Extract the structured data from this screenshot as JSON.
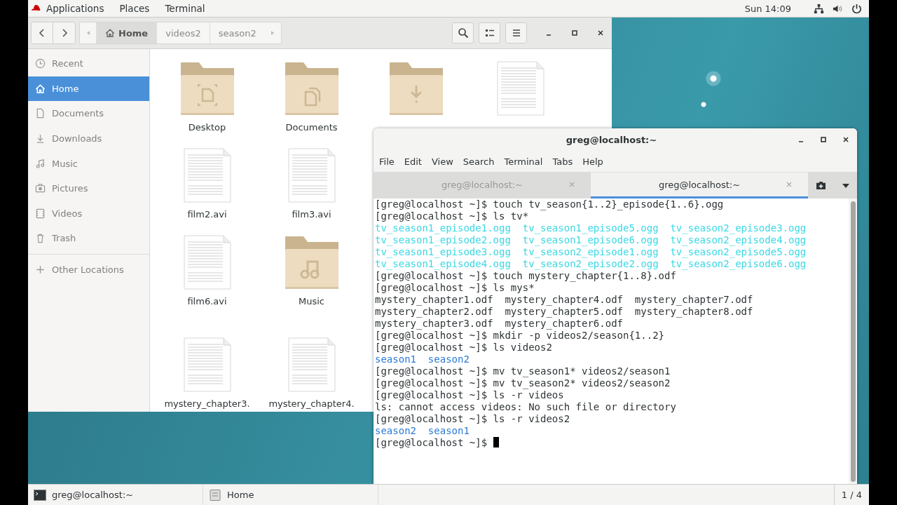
{
  "top_bar": {
    "menus": [
      "Applications",
      "Places",
      "Terminal"
    ],
    "clock": "Sun 14:09"
  },
  "file_manager": {
    "path": [
      {
        "label": "Home",
        "selected": true
      },
      {
        "label": "videos2",
        "selected": false
      },
      {
        "label": "season2",
        "selected": false
      }
    ],
    "sidebar": [
      {
        "label": "Recent",
        "kind": "recent",
        "selected": false
      },
      {
        "label": "Home",
        "kind": "home",
        "selected": true
      },
      {
        "label": "Documents",
        "kind": "documents",
        "selected": false
      },
      {
        "label": "Downloads",
        "kind": "downloads",
        "selected": false
      },
      {
        "label": "Music",
        "kind": "music",
        "selected": false
      },
      {
        "label": "Pictures",
        "kind": "pictures",
        "selected": false
      },
      {
        "label": "Videos",
        "kind": "videos",
        "selected": false
      },
      {
        "label": "Trash",
        "kind": "trash",
        "selected": false
      },
      {
        "label": "Other Locations",
        "kind": "other",
        "selected": false
      }
    ],
    "file_rows": [
      [
        {
          "name": "Desktop",
          "kind": "desktop"
        },
        {
          "name": "Documents",
          "kind": "documents"
        },
        {
          "kind": "downloads"
        },
        {
          "kind": "document"
        }
      ],
      [
        {
          "name": "film2.avi",
          "kind": "document"
        },
        {
          "name": "film3.avi",
          "kind": "document"
        }
      ],
      [
        {
          "name": "film6.avi",
          "kind": "document"
        },
        {
          "name": "Music",
          "kind": "music"
        }
      ],
      [
        {
          "name": "mystery_chapter3.",
          "kind": "document"
        },
        {
          "name": "mystery_chapter4.",
          "kind": "document"
        }
      ]
    ]
  },
  "terminal": {
    "title": "greg@localhost:~",
    "menus": [
      "File",
      "Edit",
      "View",
      "Search",
      "Terminal",
      "Tabs",
      "Help"
    ],
    "tabs": [
      {
        "label": "greg@localhost:~",
        "selected": false
      },
      {
        "label": "greg@localhost:~",
        "selected": true
      }
    ],
    "lines": [
      {
        "text": "[greg@localhost ~]$ touch tv_season{1..2}_episode{1..6}.ogg",
        "kind": "text"
      },
      {
        "text": "[greg@localhost ~]$ ls tv*",
        "kind": "text"
      },
      {
        "text": "tv_season1_episode1.ogg  tv_season1_episode5.ogg  tv_season2_episode3.ogg",
        "kind": "media"
      },
      {
        "text": "tv_season1_episode2.ogg  tv_season1_episode6.ogg  tv_season2_episode4.ogg",
        "kind": "media"
      },
      {
        "text": "tv_season1_episode3.ogg  tv_season2_episode1.ogg  tv_season2_episode5.ogg",
        "kind": "media"
      },
      {
        "text": "tv_season1_episode4.ogg  tv_season2_episode2.ogg  tv_season2_episode6.ogg",
        "kind": "media"
      },
      {
        "text": "[greg@localhost ~]$ touch mystery_chapter{1..8}.odf",
        "kind": "text"
      },
      {
        "text": "[greg@localhost ~]$ ls mys*",
        "kind": "text"
      },
      {
        "text": "mystery_chapter1.odf  mystery_chapter4.odf  mystery_chapter7.odf",
        "kind": "text"
      },
      {
        "text": "mystery_chapter2.odf  mystery_chapter5.odf  mystery_chapter8.odf",
        "kind": "text"
      },
      {
        "text": "mystery_chapter3.odf  mystery_chapter6.odf",
        "kind": "text"
      },
      {
        "text": "[greg@localhost ~]$ mkdir -p videos2/season{1..2}",
        "kind": "text"
      },
      {
        "text": "[greg@localhost ~]$ ls videos2",
        "kind": "text"
      },
      {
        "text": "season1  season2",
        "kind": "directory"
      },
      {
        "text": "[greg@localhost ~]$ mv tv_season1* videos2/season1",
        "kind": "text"
      },
      {
        "text": "[greg@localhost ~]$ mv tv_season2* videos2/season2",
        "kind": "text"
      },
      {
        "text": "[greg@localhost ~]$ ls -r videos",
        "kind": "text"
      },
      {
        "text": "ls: cannot access videos: No such file or directory",
        "kind": "text"
      },
      {
        "text": "[greg@localhost ~]$ ls -r videos2",
        "kind": "text"
      },
      {
        "text": "season2  season1",
        "kind": "directory"
      },
      {
        "text": "[greg@localhost ~]$ ",
        "kind": "text"
      }
    ]
  },
  "taskbar": {
    "windows": [
      {
        "label": "greg@localhost:~",
        "kind": "terminal"
      },
      {
        "label": "Home",
        "kind": "files"
      }
    ],
    "workspace": "1 / 4"
  }
}
